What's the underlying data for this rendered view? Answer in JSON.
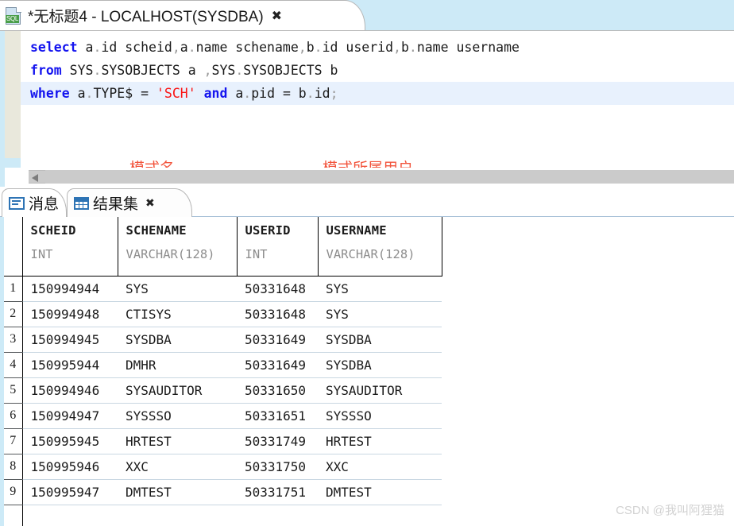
{
  "editor_tab": {
    "icon": "sql-document-icon",
    "badge": "SQL",
    "title": "*无标题4 - LOCALHOST(SYSDBA)",
    "close_glyph": "✖"
  },
  "sql": {
    "lines": [
      {
        "active": false,
        "parts": [
          {
            "t": "select",
            "k": "kw"
          },
          {
            "t": " a",
            "k": ""
          },
          {
            "t": ".",
            "k": "punct"
          },
          {
            "t": "id scheid",
            "k": ""
          },
          {
            "t": ",",
            "k": "punct"
          },
          {
            "t": "a",
            "k": ""
          },
          {
            "t": ".",
            "k": "punct"
          },
          {
            "t": "name schename",
            "k": ""
          },
          {
            "t": ",",
            "k": "punct"
          },
          {
            "t": "b",
            "k": ""
          },
          {
            "t": ".",
            "k": "punct"
          },
          {
            "t": "id userid",
            "k": ""
          },
          {
            "t": ",",
            "k": "punct"
          },
          {
            "t": "b",
            "k": ""
          },
          {
            "t": ".",
            "k": "punct"
          },
          {
            "t": "name username",
            "k": ""
          }
        ]
      },
      {
        "active": false,
        "parts": [
          {
            "t": "from",
            "k": "kw"
          },
          {
            "t": " SYS",
            "k": ""
          },
          {
            "t": ".",
            "k": "punct"
          },
          {
            "t": "SYSOBJECTS a ",
            "k": ""
          },
          {
            "t": ",",
            "k": "punct"
          },
          {
            "t": "SYS",
            "k": ""
          },
          {
            "t": ".",
            "k": "punct"
          },
          {
            "t": "SYSOBJECTS b",
            "k": ""
          }
        ]
      },
      {
        "active": true,
        "parts": [
          {
            "t": "where",
            "k": "kw"
          },
          {
            "t": " a",
            "k": ""
          },
          {
            "t": ".",
            "k": "punct"
          },
          {
            "t": "TYPE$ = ",
            "k": ""
          },
          {
            "t": "'SCH'",
            "k": "str"
          },
          {
            "t": " ",
            "k": ""
          },
          {
            "t": "and",
            "k": "kw"
          },
          {
            "t": " a",
            "k": ""
          },
          {
            "t": ".",
            "k": "punct"
          },
          {
            "t": "pid = b",
            "k": ""
          },
          {
            "t": ".",
            "k": "punct"
          },
          {
            "t": "id",
            "k": ""
          },
          {
            "t": ";",
            "k": "punct"
          }
        ]
      }
    ],
    "plain_text": "select a.id scheid,a.name schename,b.id userid,b.name username\nfrom SYS.SYSOBJECTS a ,SYS.SYSOBJECTS b\nwhere a.TYPE$ = 'SCH' and a.pid = b.id;"
  },
  "annotations": {
    "schema_name": "模式名",
    "schema_owner": "模式所属用户",
    "color": "#f2553d"
  },
  "scrollbar": {
    "left_arrow_glyph": "◀"
  },
  "result_tabs": [
    {
      "id": "messages",
      "icon": "message-icon",
      "label": "消息",
      "active": false,
      "closable": false
    },
    {
      "id": "results",
      "icon": "grid-icon",
      "label": "结果集",
      "active": true,
      "closable": true,
      "close_glyph": "✖"
    }
  ],
  "result_grid": {
    "columns": [
      {
        "name": "SCHEID",
        "type": "INT"
      },
      {
        "name": "SCHENAME",
        "type": "VARCHAR(128)"
      },
      {
        "name": "USERID",
        "type": "INT"
      },
      {
        "name": "USERNAME",
        "type": "VARCHAR(128)"
      }
    ],
    "rows": [
      {
        "n": "1",
        "cells": [
          "150994944",
          "SYS",
          "50331648",
          "SYS"
        ]
      },
      {
        "n": "2",
        "cells": [
          "150994948",
          "CTISYS",
          "50331648",
          "SYS"
        ]
      },
      {
        "n": "3",
        "cells": [
          "150994945",
          "SYSDBA",
          "50331649",
          "SYSDBA"
        ]
      },
      {
        "n": "4",
        "cells": [
          "150995944",
          "DMHR",
          "50331649",
          "SYSDBA"
        ]
      },
      {
        "n": "5",
        "cells": [
          "150994946",
          "SYSAUDITOR",
          "50331650",
          "SYSAUDITOR"
        ]
      },
      {
        "n": "6",
        "cells": [
          "150994947",
          "SYSSSO",
          "50331651",
          "SYSSSO"
        ]
      },
      {
        "n": "7",
        "cells": [
          "150995945",
          "HRTEST",
          "50331749",
          "HRTEST"
        ]
      },
      {
        "n": "8",
        "cells": [
          "150995946",
          "XXC",
          "50331750",
          "XXC"
        ]
      },
      {
        "n": "9",
        "cells": [
          "150995947",
          "DMTEST",
          "50331751",
          "DMTEST"
        ]
      }
    ]
  },
  "watermark": "CSDN @我叫阿狸猫"
}
